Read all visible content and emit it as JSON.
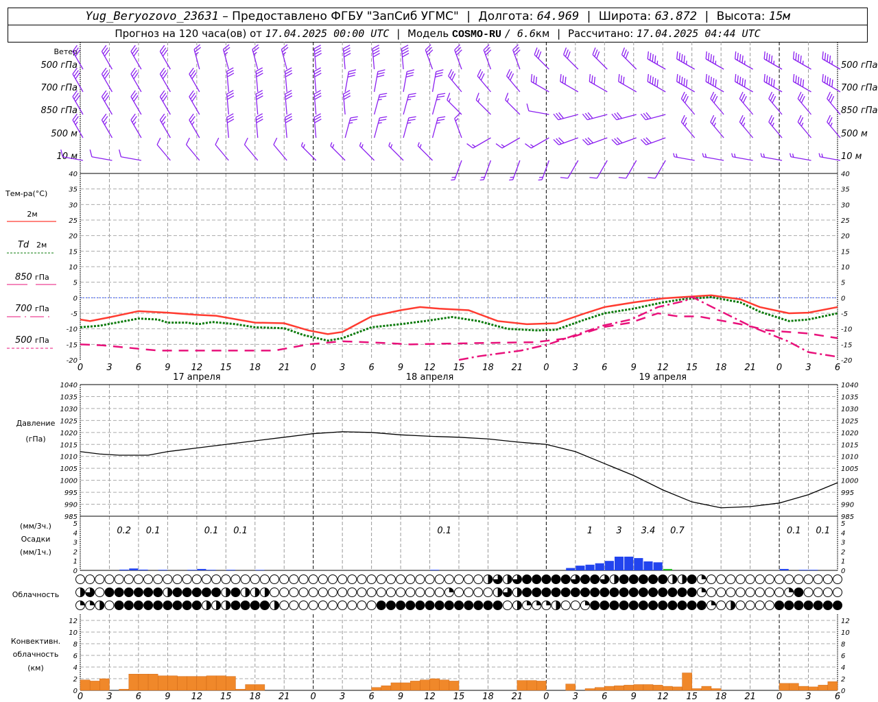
{
  "header": {
    "station": "Yug_Beryozovo_23631",
    "provider": "– Предоставлено ФГБУ \"ЗапСиб УГМС\"",
    "lon_label": "Долгота:",
    "lon": "64.969",
    "lat_label": "Широта:",
    "lat": "63.872",
    "alt_label": "Высота:",
    "alt": "15м",
    "forecast_label": "Прогноз на 120 часа(ов) от",
    "forecast_start": "17.04.2025 00:00 UTC",
    "model_label": "Модель",
    "model": "COSMO-RU",
    "resolution": "/ 6.6",
    "resolution_unit": "км",
    "calc_label": "Рассчитано:",
    "calc_time": "17.04.2025 04:44 UTC"
  },
  "x_axis": {
    "hour_ticks": [
      "0",
      "3",
      "6",
      "9",
      "12",
      "15",
      "18",
      "21",
      "0",
      "3",
      "6",
      "9",
      "12",
      "15",
      "18",
      "21",
      "0",
      "3",
      "6",
      "9",
      "12",
      "15",
      "18",
      "21",
      "0",
      "3",
      "6"
    ],
    "days": [
      "17 апреля",
      "18 апреля",
      "19 апреля"
    ]
  },
  "wind": {
    "title": "Ветер",
    "levels": [
      "500 гПа",
      "700 гПа",
      "850 гПа",
      "500 м",
      "10  м"
    ],
    "color": "#8a1ef0",
    "hours": [
      0,
      3,
      6,
      9,
      12,
      15,
      18,
      21,
      24,
      27,
      30,
      33,
      36,
      39,
      42,
      45,
      48,
      51,
      54,
      57,
      60,
      63,
      66,
      69,
      72,
      75,
      78
    ],
    "direction_deg": [
      [
        330,
        330,
        330,
        330,
        345,
        345,
        345,
        345,
        355,
        355,
        355,
        355,
        340,
        340,
        340,
        340,
        315,
        315,
        315,
        315,
        300,
        300,
        300,
        300,
        300,
        300,
        300
      ],
      [
        330,
        330,
        330,
        330,
        330,
        355,
        355,
        355,
        355,
        10,
        10,
        10,
        10,
        320,
        320,
        320,
        300,
        300,
        300,
        300,
        300,
        300,
        300,
        300,
        300,
        300,
        300
      ],
      [
        330,
        330,
        330,
        330,
        330,
        355,
        355,
        355,
        355,
        355,
        15,
        15,
        15,
        315,
        315,
        315,
        280,
        255,
        255,
        255,
        255,
        320,
        320,
        320,
        320,
        320,
        320
      ],
      [
        330,
        330,
        330,
        330,
        330,
        355,
        355,
        355,
        355,
        15,
        15,
        15,
        15,
        340,
        240,
        240,
        240,
        250,
        250,
        250,
        250,
        320,
        320,
        320,
        320,
        320,
        320
      ],
      [
        280,
        280,
        280,
        320,
        320,
        320,
        320,
        320,
        315,
        315,
        315,
        315,
        315,
        200,
        200,
        200,
        200,
        210,
        210,
        210,
        210,
        280,
        280,
        280,
        280,
        280,
        280
      ]
    ],
    "speed_ms": [
      [
        15,
        15,
        15,
        15,
        12,
        12,
        12,
        12,
        20,
        20,
        20,
        20,
        15,
        15,
        15,
        15,
        15,
        15,
        15,
        15,
        22,
        22,
        22,
        22,
        22,
        22,
        22
      ],
      [
        15,
        15,
        15,
        15,
        15,
        15,
        15,
        15,
        15,
        15,
        15,
        15,
        15,
        15,
        15,
        15,
        15,
        15,
        15,
        15,
        25,
        25,
        25,
        25,
        25,
        25,
        25
      ],
      [
        15,
        15,
        15,
        15,
        15,
        15,
        15,
        15,
        15,
        15,
        12,
        12,
        12,
        8,
        8,
        8,
        5,
        15,
        15,
        15,
        15,
        15,
        15,
        15,
        15,
        15,
        15
      ],
      [
        12,
        12,
        12,
        12,
        12,
        15,
        15,
        15,
        15,
        12,
        12,
        12,
        12,
        8,
        8,
        8,
        8,
        15,
        15,
        15,
        15,
        12,
        12,
        12,
        12,
        12,
        12
      ],
      [
        5,
        5,
        5,
        5,
        5,
        5,
        5,
        5,
        4,
        4,
        4,
        4,
        4,
        4,
        4,
        4,
        4,
        5,
        5,
        5,
        5,
        4,
        4,
        4,
        4,
        4,
        4
      ]
    ]
  },
  "temperature": {
    "title": "Тем-ра(°С)",
    "legend": {
      "t2m": "2м",
      "td_symbol": "Td",
      "td_level": "2м",
      "p850_value": "850",
      "p700_value": "700",
      "p500_value": "500",
      "unit": "гПа"
    },
    "yticks": [
      "-20",
      "-15",
      "-10",
      "-5",
      "0",
      "5",
      "10",
      "15",
      "20",
      "25",
      "30",
      "35",
      "40"
    ]
  },
  "pressure": {
    "title": "Давление",
    "unit": "(гПа)",
    "yticks": [
      "985",
      "990",
      "995",
      "1000",
      "1005",
      "1010",
      "1015",
      "1020",
      "1025",
      "1030",
      "1035",
      "1040"
    ]
  },
  "precipitation": {
    "unit3h": "(мм/3ч.)",
    "title": "Осадки",
    "unit1h": "(мм/1ч.)",
    "yticks": [
      "0",
      "1",
      "2",
      "3",
      "4",
      "5"
    ],
    "totals_3h": [
      {
        "h": 4.5,
        "label": "0.2"
      },
      {
        "h": 7.5,
        "label": "0.1"
      },
      {
        "h": 13.5,
        "label": "0.1"
      },
      {
        "h": 16.5,
        "label": "0.1"
      },
      {
        "h": 37.5,
        "label": "0.1"
      },
      {
        "h": 52.5,
        "label": "1"
      },
      {
        "h": 55.5,
        "label": "3"
      },
      {
        "h": 58.5,
        "label": "3.4"
      },
      {
        "h": 61.5,
        "label": "0.7"
      },
      {
        "h": 73.5,
        "label": "0.1"
      },
      {
        "h": 76.5,
        "label": "0.1"
      }
    ]
  },
  "cloudiness": {
    "title": "Облачность",
    "rows": [
      "00000000000000000000000000000000000000000023234444434432444442241000000000000000",
      "230444444244444242220000000000000000001000023244444444444444444410000000014 0000",
      "1120444444444222444420000000000444444444444402111200144444444444410200004444444"
    ]
  },
  "convective": {
    "title1": "Конвективн.",
    "title2": "облачность",
    "unit": "(км)",
    "yticks": [
      "0",
      "2",
      "4",
      "6",
      "8",
      "10",
      "12"
    ],
    "color": "#f0882a"
  },
  "chart_data": {
    "type": "line",
    "x_unit": "hours from 17.04.2025 00 UTC",
    "xlim": [
      0,
      78
    ],
    "temperature": {
      "ylim": [
        -20,
        40
      ],
      "grid": true,
      "series": [
        {
          "name": "2м",
          "color": "#ff3b30",
          "points": [
            [
              0,
              -7
            ],
            [
              1,
              -7.5
            ],
            [
              3,
              -6.3
            ],
            [
              6,
              -4.3
            ],
            [
              9,
              -4.8
            ],
            [
              12,
              -5.5
            ],
            [
              14,
              -5.8
            ],
            [
              18,
              -8
            ],
            [
              21,
              -8.2
            ],
            [
              23.5,
              -10.5
            ],
            [
              25.5,
              -11.7
            ],
            [
              27,
              -11
            ],
            [
              30,
              -6
            ],
            [
              33,
              -4
            ],
            [
              35,
              -3
            ],
            [
              37,
              -3.5
            ],
            [
              40,
              -4
            ],
            [
              43,
              -7.5
            ],
            [
              46,
              -8.5
            ],
            [
              49,
              -8.2
            ],
            [
              52,
              -5
            ],
            [
              54,
              -3
            ],
            [
              57,
              -1.5
            ],
            [
              60,
              -0.2
            ],
            [
              62,
              0.2
            ],
            [
              65,
              0.8
            ],
            [
              68,
              -0.5
            ],
            [
              70,
              -3
            ],
            [
              73,
              -5
            ],
            [
              75,
              -4.8
            ],
            [
              78,
              -3
            ]
          ]
        },
        {
          "name": "Td 2м",
          "color": "#0a7a0a",
          "points": [
            [
              0,
              -9.5
            ],
            [
              2,
              -9
            ],
            [
              6,
              -6.7
            ],
            [
              8,
              -7
            ],
            [
              9,
              -8
            ],
            [
              11,
              -8
            ],
            [
              12.2,
              -8.5
            ],
            [
              13.6,
              -7.8
            ],
            [
              16,
              -8.5
            ],
            [
              18,
              -9.5
            ],
            [
              21,
              -9.8
            ],
            [
              23,
              -12
            ],
            [
              25.5,
              -13.8
            ],
            [
              27,
              -13
            ],
            [
              30,
              -9.5
            ],
            [
              33,
              -8.5
            ],
            [
              35.5,
              -7.5
            ],
            [
              38.3,
              -6.2
            ],
            [
              41,
              -7.5
            ],
            [
              44,
              -10
            ],
            [
              47,
              -10.5
            ],
            [
              49,
              -10.3
            ],
            [
              52,
              -7
            ],
            [
              54,
              -5
            ],
            [
              57,
              -3.5
            ],
            [
              60,
              -1.5
            ],
            [
              62,
              -0.5
            ],
            [
              65,
              0.2
            ],
            [
              68,
              -1.5
            ],
            [
              70,
              -4.5
            ],
            [
              73,
              -7.5
            ],
            [
              75,
              -7
            ],
            [
              78,
              -5
            ]
          ]
        },
        {
          "name": "850 гПа",
          "color": "#e8107a",
          "points": [
            [
              0,
              -15
            ],
            [
              2.3,
              -15.3
            ],
            [
              8,
              -17
            ],
            [
              12,
              -17
            ],
            [
              20,
              -17
            ],
            [
              23.5,
              -15
            ],
            [
              27,
              -14
            ],
            [
              31,
              -14.5
            ],
            [
              34,
              -15
            ],
            [
              37,
              -14.8
            ],
            [
              42.5,
              -14.5
            ],
            [
              46.8,
              -14.3
            ],
            [
              50.3,
              -13
            ],
            [
              53.8,
              -9.5
            ],
            [
              56.7,
              -8
            ],
            [
              59.5,
              -5
            ],
            [
              61.6,
              -6
            ],
            [
              63.7,
              -6
            ],
            [
              68,
              -8.5
            ],
            [
              70.8,
              -10.5
            ],
            [
              75,
              -11.5
            ],
            [
              78,
              -13
            ]
          ]
        },
        {
          "name": "700 гПа",
          "color": "#e8107a",
          "points": [
            [
              39,
              -20
            ],
            [
              41.1,
              -18.8
            ],
            [
              45.4,
              -17
            ],
            [
              48.2,
              -15
            ],
            [
              51,
              -12
            ],
            [
              53.8,
              -9
            ],
            [
              56.7,
              -7
            ],
            [
              59.5,
              -3
            ],
            [
              62.3,
              -1
            ],
            [
              63,
              0.3
            ],
            [
              65.1,
              -3
            ],
            [
              68,
              -7.5
            ],
            [
              69.3,
              -9.5
            ],
            [
              72.9,
              -14
            ],
            [
              75,
              -17.5
            ],
            [
              78,
              -19
            ]
          ]
        }
      ]
    },
    "pressure": {
      "ylim": [
        985,
        1040
      ],
      "color": "#000000",
      "points": [
        [
          0,
          1012
        ],
        [
          2,
          1011
        ],
        [
          4,
          1010.5
        ],
        [
          7,
          1010.5
        ],
        [
          9,
          1012
        ],
        [
          12,
          1013.5
        ],
        [
          15,
          1015
        ],
        [
          18,
          1016.5
        ],
        [
          21,
          1018
        ],
        [
          24,
          1019.5
        ],
        [
          27,
          1020.3
        ],
        [
          30,
          1020
        ],
        [
          33,
          1019
        ],
        [
          36,
          1018.4
        ],
        [
          39,
          1018
        ],
        [
          42,
          1017.3
        ],
        [
          45,
          1016
        ],
        [
          48,
          1015
        ],
        [
          51,
          1012
        ],
        [
          54,
          1007
        ],
        [
          57,
          1002
        ],
        [
          60,
          996
        ],
        [
          63,
          991
        ],
        [
          66,
          988.5
        ],
        [
          69,
          989
        ],
        [
          72,
          990.5
        ],
        [
          75,
          994
        ],
        [
          78,
          999
        ]
      ]
    },
    "precip_1h": {
      "ylim": [
        0,
        5
      ],
      "color": "#2244ee",
      "bars": [
        {
          "h": 5,
          "v": 0.08
        },
        {
          "h": 6,
          "v": 0.2
        },
        {
          "h": 7,
          "v": 0.08
        },
        {
          "h": 9,
          "v": 0.06
        },
        {
          "h": 12,
          "v": 0.06
        },
        {
          "h": 13,
          "v": 0.15
        },
        {
          "h": 14,
          "v": 0.06
        },
        {
          "h": 16,
          "v": 0.06
        },
        {
          "h": 19,
          "v": 0.05
        },
        {
          "h": 37,
          "v": 0.06
        },
        {
          "h": 51,
          "v": 0.25
        },
        {
          "h": 52,
          "v": 0.5
        },
        {
          "h": 53,
          "v": 0.6
        },
        {
          "h": 54,
          "v": 0.75
        },
        {
          "h": 55,
          "v": 1.0
        },
        {
          "h": 56,
          "v": 1.45
        },
        {
          "h": 57,
          "v": 1.45
        },
        {
          "h": 58,
          "v": 1.3
        },
        {
          "h": 59,
          "v": 0.95
        },
        {
          "h": 60,
          "v": 0.85
        },
        {
          "h": 61,
          "v": 0.15,
          "color": "#22bb22"
        },
        {
          "h": 73,
          "v": 0.15
        },
        {
          "h": 75,
          "v": 0.06
        },
        {
          "h": 76,
          "v": 0.06
        }
      ]
    },
    "convective_km": {
      "ylim": [
        0,
        13
      ],
      "values": [
        1.8,
        1.6,
        2.0,
        0,
        0.2,
        2.8,
        2.8,
        2.8,
        2.5,
        2.5,
        2.4,
        2.4,
        2.4,
        2.5,
        2.5,
        2.4,
        0.2,
        1.0,
        1.0,
        0,
        0,
        0,
        0,
        0,
        0,
        0,
        0,
        0,
        0,
        0,
        0.5,
        0.8,
        1.3,
        1.3,
        1.6,
        1.8,
        2.0,
        1.8,
        1.6,
        0,
        0,
        0,
        0,
        0,
        0,
        1.7,
        1.7,
        1.6,
        0,
        0,
        1.1,
        0,
        0.3,
        0.5,
        0.7,
        0.8,
        0.9,
        1.0,
        1.0,
        0.9,
        0.7,
        0.6,
        3.0,
        0.3,
        0.7,
        0.3,
        0,
        0,
        0,
        0,
        0,
        0,
        1.2,
        1.2,
        0.7,
        0.6,
        0.9,
        1.5
      ]
    }
  }
}
